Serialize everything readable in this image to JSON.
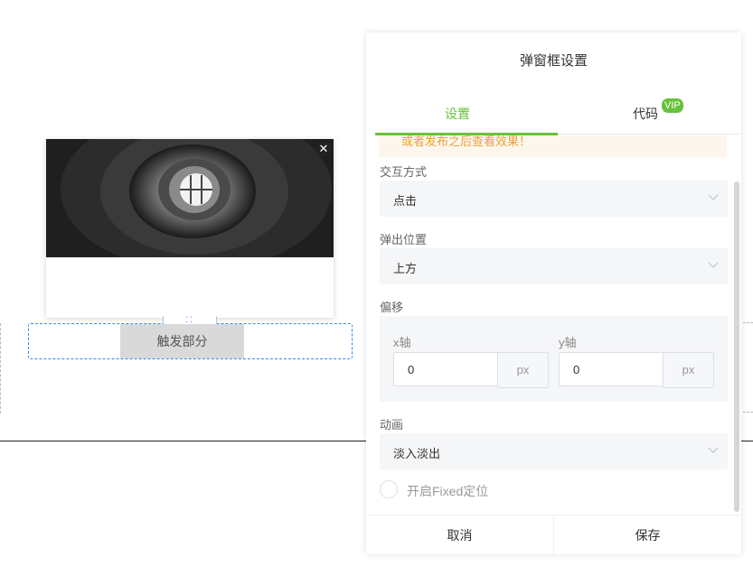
{
  "canvas": {
    "trigger_label": "触发部分",
    "drag_handle_glyph": "⁚⁚",
    "close_glyph": "✕"
  },
  "panel": {
    "title": "弹窗框设置",
    "tabs": [
      {
        "label": "设置",
        "active": true
      },
      {
        "label": "代码",
        "badge": "VIP"
      }
    ],
    "notice": "或者发布之后查看效果！",
    "interaction": {
      "label": "交互方式",
      "value": "点击"
    },
    "position": {
      "label": "弹出位置",
      "value": "上方"
    },
    "offset": {
      "label": "偏移",
      "x": {
        "label": "x轴",
        "value": "0",
        "unit": "px"
      },
      "y": {
        "label": "y轴",
        "value": "0",
        "unit": "px"
      }
    },
    "animation": {
      "label": "动画",
      "value": "淡入淡出"
    },
    "fixed": {
      "label": "开启Fixed定位",
      "checked": false
    },
    "footer": {
      "cancel": "取消",
      "save": "保存"
    }
  },
  "colors": {
    "accent": "#67c23a",
    "notice_bg": "#fdf6ec",
    "notice_text": "#e6a23c",
    "dashed_border": "#2d8cf0"
  }
}
